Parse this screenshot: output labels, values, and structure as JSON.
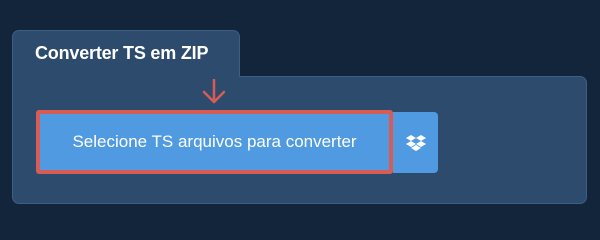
{
  "panel": {
    "title": "Converter TS em ZIP"
  },
  "upload": {
    "select_label": "Selecione TS arquivos para converter",
    "dropbox_icon": "dropbox-icon"
  },
  "colors": {
    "page_background": "#13253a",
    "panel_background": "#2d4b6c",
    "button_blue": "#4f9ae0",
    "highlight_red": "#d85c56"
  }
}
